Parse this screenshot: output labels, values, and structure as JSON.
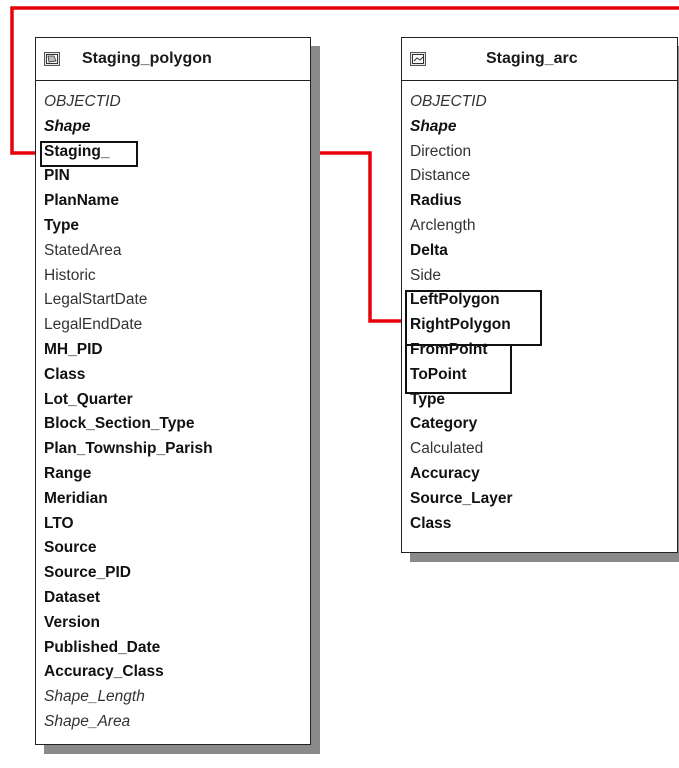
{
  "tables": [
    {
      "title": "Staging_polygon",
      "icon": "polygon-feature-class-icon",
      "fields": [
        {
          "name": "OBJECTID",
          "style": "italic"
        },
        {
          "name": "Shape",
          "style": "boldi"
        },
        {
          "name": "Staging_",
          "style": "bold"
        },
        {
          "name": "PIN",
          "style": "bold"
        },
        {
          "name": "PlanName",
          "style": "bold"
        },
        {
          "name": "Type",
          "style": "bold"
        },
        {
          "name": "StatedArea",
          "style": "normal"
        },
        {
          "name": "Historic",
          "style": "normal"
        },
        {
          "name": "LegalStartDate",
          "style": "normal"
        },
        {
          "name": "LegalEndDate",
          "style": "normal"
        },
        {
          "name": "MH_PID",
          "style": "bold"
        },
        {
          "name": "Class",
          "style": "bold"
        },
        {
          "name": "Lot_Quarter",
          "style": "bold"
        },
        {
          "name": "Block_Section_Type",
          "style": "bold"
        },
        {
          "name": "Plan_Township_Parish",
          "style": "bold"
        },
        {
          "name": "Range",
          "style": "bold"
        },
        {
          "name": "Meridian",
          "style": "bold"
        },
        {
          "name": "LTO",
          "style": "bold"
        },
        {
          "name": "Source",
          "style": "bold"
        },
        {
          "name": "Source_PID",
          "style": "bold"
        },
        {
          "name": "Dataset",
          "style": "bold"
        },
        {
          "name": "Version",
          "style": "bold"
        },
        {
          "name": "Published_Date",
          "style": "bold"
        },
        {
          "name": "Accuracy_Class",
          "style": "bold"
        },
        {
          "name": "Shape_Length",
          "style": "italic"
        },
        {
          "name": "Shape_Area",
          "style": "italic"
        }
      ]
    },
    {
      "title": "Staging_arc",
      "icon": "line-feature-class-icon",
      "fields": [
        {
          "name": "OBJECTID",
          "style": "italic"
        },
        {
          "name": "Shape",
          "style": "boldi"
        },
        {
          "name": "Direction",
          "style": "normal"
        },
        {
          "name": "Distance",
          "style": "normal"
        },
        {
          "name": "Radius",
          "style": "bold"
        },
        {
          "name": "Arclength",
          "style": "normal"
        },
        {
          "name": "Delta",
          "style": "bold"
        },
        {
          "name": "Side",
          "style": "normal"
        },
        {
          "name": "LeftPolygon",
          "style": "bold"
        },
        {
          "name": "RightPolygon",
          "style": "bold"
        },
        {
          "name": "FromPoint",
          "style": "bold"
        },
        {
          "name": "ToPoint",
          "style": "bold"
        },
        {
          "name": "Type",
          "style": "bold"
        },
        {
          "name": "Category",
          "style": "bold"
        },
        {
          "name": "Calculated",
          "style": "normal"
        },
        {
          "name": "Accuracy",
          "style": "bold"
        },
        {
          "name": "Source_Layer",
          "style": "bold"
        },
        {
          "name": "Class",
          "style": "bold"
        }
      ]
    }
  ],
  "relationships": [
    {
      "from": "Staging_polygon.Staging_",
      "to": "offscreen-top"
    },
    {
      "from": "Staging_polygon.Staging_",
      "to": "Staging_arc.LeftPolygon/RightPolygon"
    },
    {
      "from": "Staging_arc.FromPoint/ToPoint",
      "to": "offscreen-right"
    }
  ],
  "colors": {
    "link": "#e8000b",
    "border": "#222222",
    "shadow": "#8a8a8a"
  }
}
